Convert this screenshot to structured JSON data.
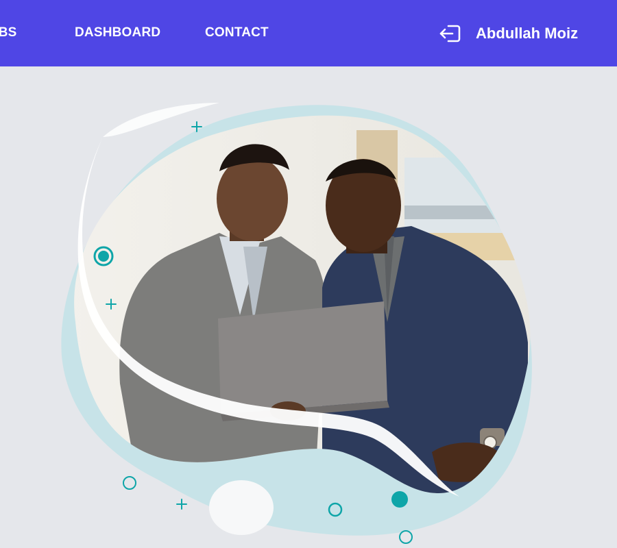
{
  "navbar": {
    "background": "#4f46e5",
    "links": [
      {
        "label": "JOBS"
      },
      {
        "label": "DASHBOARD"
      },
      {
        "label": "CONTACT"
      }
    ],
    "user": {
      "icon": "logout-icon",
      "name": "Abdullah Moiz"
    }
  },
  "hero": {
    "image_alt": "Two businessmen looking at a laptop",
    "accent_color": "#0ea5a8",
    "blob_color": "#c7e3e8"
  }
}
